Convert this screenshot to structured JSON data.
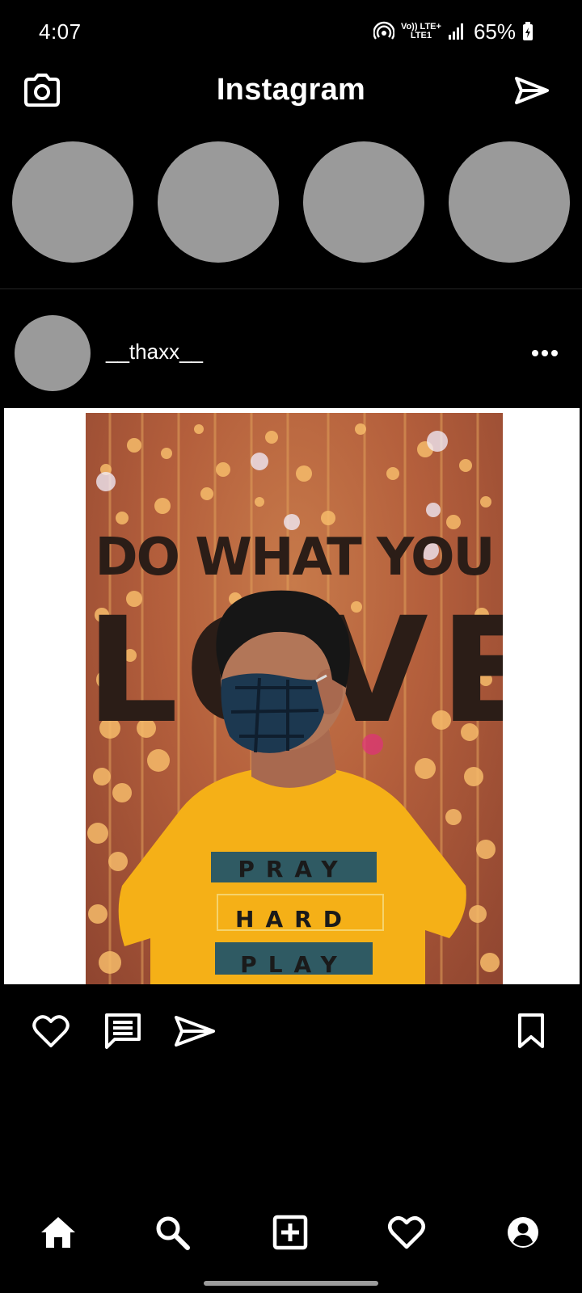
{
  "status_bar": {
    "time": "4:07",
    "network_top": "Vo)) LTE+",
    "network_bottom": "LTE1",
    "battery": "65%"
  },
  "header": {
    "title": "Instagram",
    "camera_icon": "camera-icon",
    "direct_icon": "paper-plane-icon"
  },
  "stories": [
    {
      "label": ""
    },
    {
      "label": ""
    },
    {
      "label": ""
    },
    {
      "label": ""
    }
  ],
  "post": {
    "username": "__thaxx__",
    "more_icon": "more-horizontal-icon",
    "image": {
      "text_line_1": "DO WHAT YOU",
      "text_line_2": "LOVE",
      "shirt_line_1": "PRAY",
      "shirt_line_2": "HARD",
      "shirt_line_3": "PLAY"
    },
    "actions": {
      "like_icon": "heart-icon",
      "comment_icon": "comment-icon",
      "share_icon": "paper-plane-icon",
      "save_icon": "bookmark-icon"
    }
  },
  "bottom_nav": [
    {
      "name": "home",
      "icon": "home-icon"
    },
    {
      "name": "search",
      "icon": "search-icon"
    },
    {
      "name": "add",
      "icon": "add-square-icon"
    },
    {
      "name": "activity",
      "icon": "heart-icon"
    },
    {
      "name": "profile",
      "icon": "profile-icon"
    }
  ],
  "colors": {
    "background": "#000000",
    "placeholder": "#9a9a9a",
    "text": "#ffffff"
  }
}
